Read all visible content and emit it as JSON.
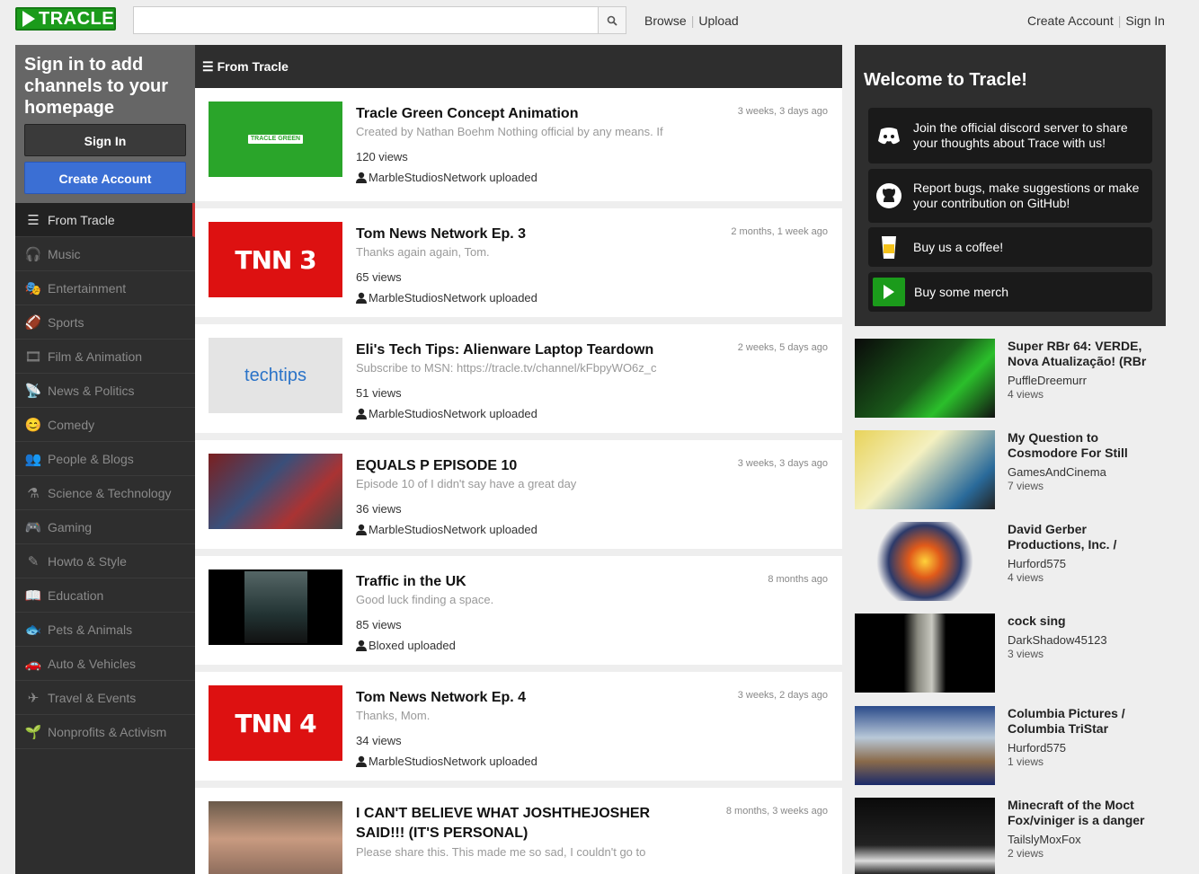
{
  "header": {
    "logo_text": "TRACLE",
    "search_placeholder": "",
    "browse": "Browse",
    "upload": "Upload",
    "create_account": "Create Account",
    "sign_in": "Sign In"
  },
  "sidebar": {
    "prompt": "Sign in to add channels to your homepage",
    "signin_label": "Sign In",
    "create_label": "Create Account",
    "items": [
      {
        "label": "From Tracle",
        "icon": "list-icon"
      },
      {
        "label": "Music",
        "icon": "headphones-icon"
      },
      {
        "label": "Entertainment",
        "icon": "theater-icon"
      },
      {
        "label": "Sports",
        "icon": "football-icon"
      },
      {
        "label": "Film & Animation",
        "icon": "film-icon"
      },
      {
        "label": "News & Politics",
        "icon": "broadcast-icon"
      },
      {
        "label": "Comedy",
        "icon": "mask-icon"
      },
      {
        "label": "People & Blogs",
        "icon": "people-icon"
      },
      {
        "label": "Science & Technology",
        "icon": "flask-icon"
      },
      {
        "label": "Gaming",
        "icon": "gamepad-icon"
      },
      {
        "label": "Howto & Style",
        "icon": "wand-icon"
      },
      {
        "label": "Education",
        "icon": "book-icon"
      },
      {
        "label": "Pets & Animals",
        "icon": "fish-icon"
      },
      {
        "label": "Auto & Vehicles",
        "icon": "car-icon"
      },
      {
        "label": "Travel & Events",
        "icon": "plane-icon"
      },
      {
        "label": "Nonprofits & Activism",
        "icon": "seedling-icon"
      }
    ]
  },
  "feed": {
    "heading": "From Tracle",
    "videos": [
      {
        "title": "Tracle Green Concept Animation",
        "time": "3 weeks, 3 days ago",
        "desc": "Created by Nathan Boehm Nothing official by any means. If",
        "views": "120 views",
        "uploader": "MarbleStudiosNetwork uploaded",
        "thumb_text": "TRACLE GREEN"
      },
      {
        "title": "Tom News Network Ep. 3",
        "time": "2 months, 1 week ago",
        "desc": "Thanks again again, Tom.",
        "views": "65 views",
        "uploader": "MarbleStudiosNetwork uploaded",
        "thumb_text": "TNN 3"
      },
      {
        "title": "Eli's Tech Tips: Alienware Laptop Teardown",
        "time": "2 weeks, 5 days ago",
        "desc": "Subscribe to MSN: https://tracle.tv/channel/kFbpyWO6z_c",
        "views": "51 views",
        "uploader": "MarbleStudiosNetwork uploaded",
        "thumb_text": "techtips"
      },
      {
        "title": "EQUALS P EPISODE 10",
        "time": "3 weeks, 3 days ago",
        "desc": "Episode 10 of I didn't say have a great day",
        "views": "36 views",
        "uploader": "MarbleStudiosNetwork uploaded"
      },
      {
        "title": "Traffic in the UK",
        "time": "8 months ago",
        "desc": "Good luck finding a space.",
        "views": "85 views",
        "uploader": "Bloxed uploaded"
      },
      {
        "title": "Tom News Network Ep. 4",
        "time": "3 weeks, 2 days ago",
        "desc": "Thanks, Mom.",
        "views": "34 views",
        "uploader": "MarbleStudiosNetwork uploaded",
        "thumb_text": "TNN 4"
      },
      {
        "title": "I CAN'T BELIEVE WHAT JOSHTHEJOSHER SAID!!! (IT'S PERSONAL)",
        "time": "8 months, 3 weeks ago",
        "desc": "Please share this. This made me so sad, I couldn't go to",
        "views": "",
        "uploader": ""
      }
    ]
  },
  "welcome": {
    "title": "Welcome to Tracle!",
    "links": [
      {
        "text": "Join the official discord server to share your thoughts about Trace with us!",
        "icon": "discord-icon"
      },
      {
        "text": "Report bugs, make suggestions or make your contribution on GitHub!",
        "icon": "github-icon"
      },
      {
        "text": "Buy us a coffee!",
        "icon": "coffee-icon"
      },
      {
        "text": "Buy some merch",
        "icon": "play-icon"
      }
    ]
  },
  "side_videos": [
    {
      "title": "Super RBr 64: VERDE, Nova Atualização! (RBr",
      "user": "PuffleDreemurr",
      "views": "4 views"
    },
    {
      "title": "My Question to Cosmodore For Still",
      "user": "GamesAndCinema",
      "views": "7 views"
    },
    {
      "title": "David Gerber Productions, Inc. /",
      "user": "Hurford575",
      "views": "4 views"
    },
    {
      "title": "cock sing",
      "user": "DarkShadow45123",
      "views": "3 views"
    },
    {
      "title": "Columbia Pictures / Columbia TriStar",
      "user": "Hurford575",
      "views": "1 views"
    },
    {
      "title": "Minecraft of the Moct Fox/viniger is a danger",
      "user": "TailslyMoxFox",
      "views": "2 views"
    }
  ]
}
